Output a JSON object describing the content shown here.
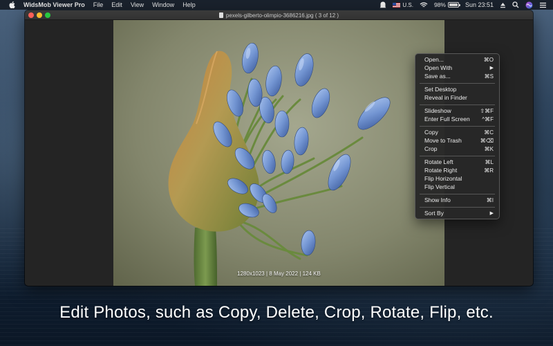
{
  "menubar": {
    "app_name": "WidsMob Viewer Pro",
    "menus": [
      "File",
      "Edit",
      "View",
      "Window",
      "Help"
    ],
    "input_source": "U.S.",
    "battery_percent": "98%",
    "battery_level": 0.98,
    "clock": "Sun 23:51"
  },
  "window": {
    "title": "pexels-gilberto-olimpio-3686216.jpg ( 3 of 12 )"
  },
  "photo": {
    "info": "1280x1023 | 8 May 2022 | 124 KB"
  },
  "context_menu": {
    "items": [
      {
        "label": "Open...",
        "shortcut": "⌘O"
      },
      {
        "label": "Open With",
        "shortcut": "▶"
      },
      {
        "label": "Save as...",
        "shortcut": "⌘S"
      },
      {
        "label": "Set Desktop",
        "shortcut": ""
      },
      {
        "label": "Reveal in Finder",
        "shortcut": ""
      },
      {
        "label": "Slideshow",
        "shortcut": "⇧⌘F"
      },
      {
        "label": "Enter Full Screen",
        "shortcut": "^⌘F"
      },
      {
        "label": "Copy",
        "shortcut": "⌘C"
      },
      {
        "label": "Move to Trash",
        "shortcut": "⌘⌫"
      },
      {
        "label": "Crop",
        "shortcut": "⌘K"
      },
      {
        "label": "Rotate Left",
        "shortcut": "⌘L"
      },
      {
        "label": "Rotate Right",
        "shortcut": "⌘R"
      },
      {
        "label": "Flip Horizontal",
        "shortcut": ""
      },
      {
        "label": "Flip Vertical",
        "shortcut": ""
      },
      {
        "label": "Show Info",
        "shortcut": "⌘I"
      },
      {
        "label": "Sort By",
        "shortcut": "▶"
      }
    ]
  },
  "caption": "Edit Photos, such as Copy, Delete, Crop, Rotate, Flip, etc.",
  "colors": {
    "close": "#fe5f57",
    "minimize": "#febc2e",
    "maximize": "#28c840",
    "bud_blue": "#7f9fd6",
    "stem_green": "#5d7a3c"
  }
}
